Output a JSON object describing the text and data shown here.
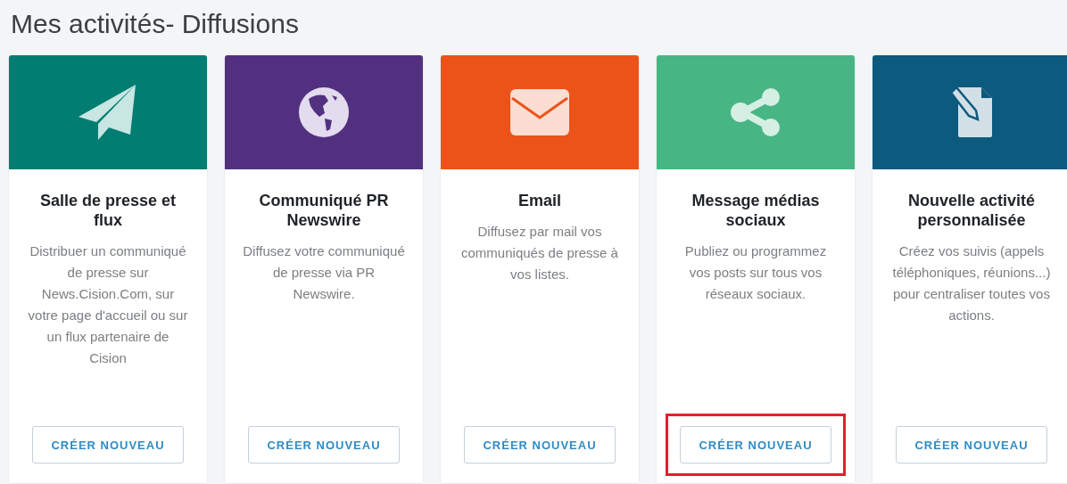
{
  "page": {
    "title": "Mes activités- Diffusions"
  },
  "cards": [
    {
      "title": "Salle de presse et flux",
      "description": "Distribuer un communiqué de presse sur News.Cision.Com, sur votre page d'accueil ou sur un flux partenaire de Cision",
      "button": "CRÉER NOUVEAU",
      "color": "#017d72",
      "highlighted": false
    },
    {
      "title": "Communiqué PR Newswire",
      "description": "Diffusez votre communiqué de presse via PR Newswire.",
      "button": "CRÉER NOUVEAU",
      "color": "#51317f",
      "highlighted": false
    },
    {
      "title": "Email",
      "description": "Diffusez par mail vos communiqués de presse à vos listes.",
      "button": "CRÉER NOUVEAU",
      "color": "#ec5319",
      "highlighted": false
    },
    {
      "title": "Message médias sociaux",
      "description": "Publiez ou programmez vos posts sur tous vos réseaux sociaux.",
      "button": "CRÉER NOUVEAU",
      "color": "#48b585",
      "highlighted": true
    },
    {
      "title": "Nouvelle activité personnalisée",
      "description": "Créez vos suivis (appels téléphoniques, réunions...) pour centraliser toutes vos actions.",
      "button": "CRÉER NOUVEAU",
      "color": "#0c5a7e",
      "highlighted": false
    }
  ]
}
